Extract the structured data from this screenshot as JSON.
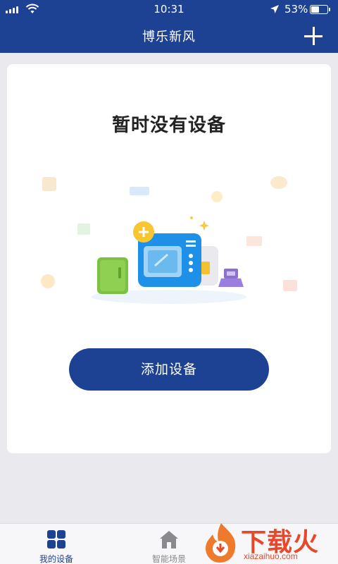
{
  "status_bar": {
    "time": "10:31",
    "battery_percent": "53%",
    "battery_level": 0.53
  },
  "header": {
    "title": "博乐新风",
    "add_icon": "plus-icon"
  },
  "main": {
    "empty_title": "暂时没有设备",
    "add_button_label": "添加设备",
    "illustration_icons": [
      "fridge-icon",
      "microwave-icon",
      "toaster-icon",
      "range-hood-icon",
      "plus-badge-icon"
    ]
  },
  "tabs": [
    {
      "label": "我的设备",
      "icon": "grid-icon",
      "active": true
    },
    {
      "label": "智能场景",
      "icon": "home-icon",
      "active": false
    }
  ],
  "watermark": {
    "text": "下载火",
    "url": "xiazaihuo.com"
  },
  "colors": {
    "brand_blue": "#1e4293",
    "background": "#e9e9ee",
    "watermark": "#e8472a"
  }
}
